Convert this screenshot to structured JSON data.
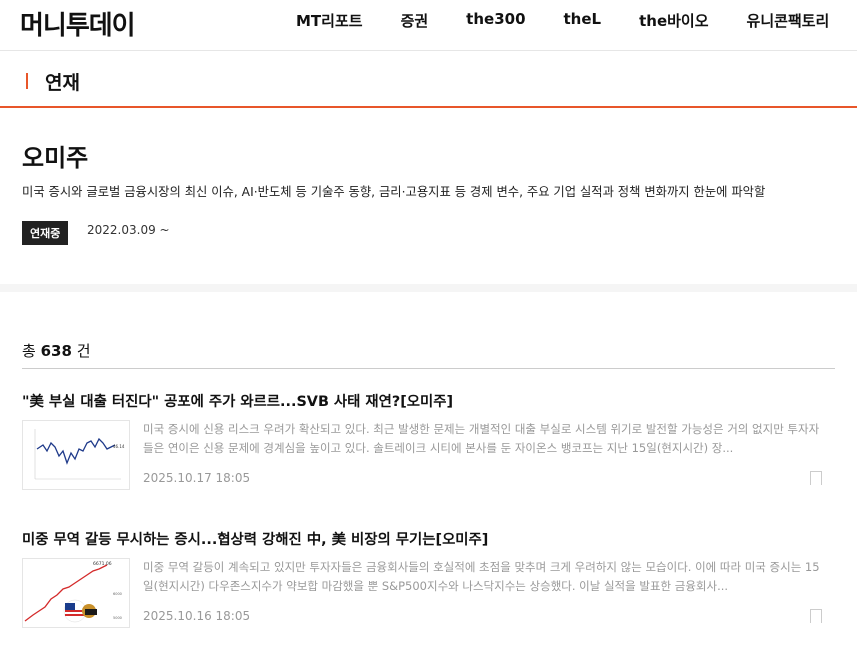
{
  "header": {
    "logo": "머니투데이",
    "nav": [
      "MT리포트",
      "증권",
      "the300",
      "theL",
      "the바이오",
      "유니콘팩토리"
    ]
  },
  "section": {
    "title": "연재"
  },
  "series": {
    "name": "오미주",
    "description": "미국 증시와 글로벌 금융시장의 최신 이슈, AI·반도체 등 기술주 동향, 금리·고용지표 등 경제 변수, 주요 기업 실적과 정책 변화까지 한눈에 파악할",
    "status_badge": "연재중",
    "start_date": "2022.03.09 ~"
  },
  "list": {
    "total_prefix": "총",
    "total_count": "638",
    "total_suffix": "건",
    "articles": [
      {
        "title": "\"美 부실 대출 터진다\" 공포에 주가 와르르...SVB 사태 재연?[오미주]",
        "summary": "미국 증시에 신용 리스크 우려가 확산되고 있다. 최근 발생한 문제는 개별적인 대출 부실로 시스템 위기로 발전할 가능성은 거의 없지만 투자자들은 연이은 신용 문제에 경계심을 높이고 있다. 솔트레이크 시티에 본사를 둔 자이온스 뱅코프는 지난 15일(현지시간) 장...",
        "date": "2025.10.17  18:05"
      },
      {
        "title": "미중 무역 갈등 무시하는 증시...협상력 강해진 中, 美 비장의 무기는[오미주]",
        "summary": "미중 무역 갈등이 계속되고 있지만 투자자들은 금융회사들의 호실적에 초점을 맞추며 크게 우려하지 않는 모습이다. 이에 따라 미국 증시는 15일(현지시간) 다우존스지수가 약보합 마감했을 뿐 S&P500지수와 나스닥지수는 상승했다. 이날 실적을 발표한 금융회사...",
        "date": "2025.10.16  18:05",
        "thumb_label": "6671.06"
      }
    ]
  },
  "colors": {
    "accent": "#e8562a",
    "badge_bg": "#222222"
  }
}
